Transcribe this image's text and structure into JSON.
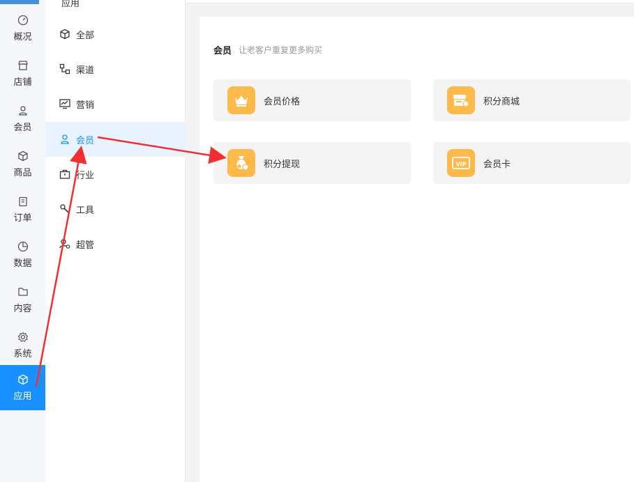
{
  "rail": {
    "items": [
      {
        "label": "概况",
        "icon": "dashboard-icon"
      },
      {
        "label": "店铺",
        "icon": "store-icon"
      },
      {
        "label": "会员",
        "icon": "user-icon"
      },
      {
        "label": "商品",
        "icon": "cube-icon"
      },
      {
        "label": "订单",
        "icon": "clipboard-icon"
      },
      {
        "label": "数据",
        "icon": "pie-chart-icon"
      },
      {
        "label": "内容",
        "icon": "folder-icon"
      },
      {
        "label": "系统",
        "icon": "gear-icon"
      },
      {
        "label": "应用",
        "icon": "cube-icon",
        "active": true
      }
    ]
  },
  "sub": {
    "title": "应用",
    "items": [
      {
        "label": "全部",
        "icon": "cube-icon"
      },
      {
        "label": "渠道",
        "icon": "channel-icon"
      },
      {
        "label": "营销",
        "icon": "chart-monitor-icon"
      },
      {
        "label": "会员",
        "icon": "user-icon",
        "active": true
      },
      {
        "label": "行业",
        "icon": "briefcase-icon"
      },
      {
        "label": "工具",
        "icon": "tool-icon"
      },
      {
        "label": "超管",
        "icon": "admin-user-icon"
      }
    ]
  },
  "section": {
    "title": "会员",
    "desc": "让老客户重复更多购买"
  },
  "cards": [
    {
      "label": "会员价格",
      "icon": "crown-icon"
    },
    {
      "label": "积分商城",
      "icon": "shop-points-icon"
    },
    {
      "label": "积分提现",
      "icon": "money-bag-icon"
    },
    {
      "label": "会员卡",
      "icon": "vip-card-icon"
    }
  ],
  "colors": {
    "accent": "#1890ff",
    "card_icon": "#fdb94a",
    "arrow": "#f03030"
  }
}
